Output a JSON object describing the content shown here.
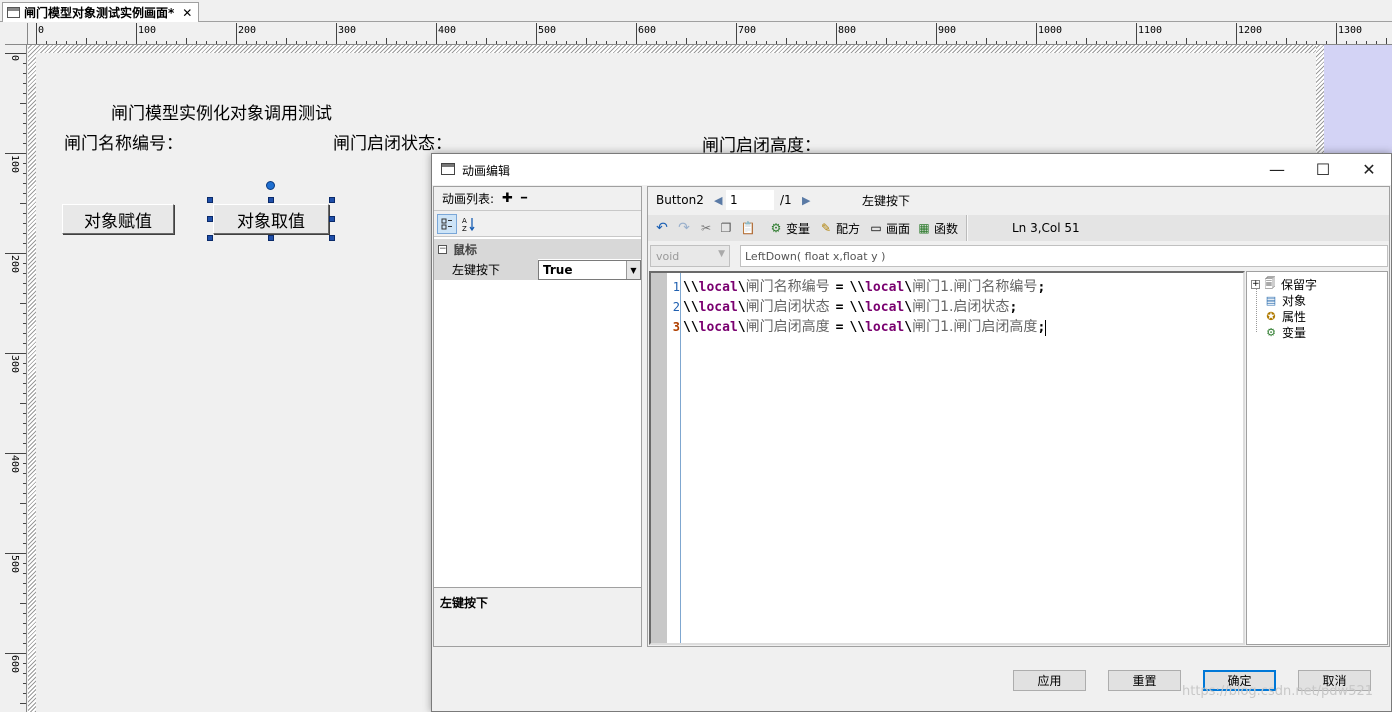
{
  "doc_tab": {
    "title": "闸门模型对象测试实例画面*",
    "close": "✕"
  },
  "ruler_h_labels": [
    "0",
    "100",
    "200",
    "300",
    "400",
    "500",
    "600",
    "700",
    "800",
    "900",
    "1000",
    "1100",
    "1200",
    "1300"
  ],
  "ruler_v_labels": [
    "0",
    "100",
    "200",
    "300",
    "400",
    "500",
    "600"
  ],
  "canvas": {
    "title": "闸门模型实例化对象调用测试",
    "label_name": "闸门名称编号：",
    "label_state": "闸门启闭状态：",
    "label_height": "闸门启闭高度：",
    "btn_assign": "对象赋值",
    "btn_get": "对象取值"
  },
  "dialog": {
    "title": "动画编辑",
    "win_min": "—",
    "win_max": "☐",
    "win_close": "✕",
    "anim_list_label": "动画列表:",
    "add_icon": "✚",
    "remove_icon": "━",
    "category": "鼠标",
    "category_toggle": "−",
    "property_name": "左键按下",
    "property_value": "True",
    "description": "左键按下",
    "object_name": "Button2",
    "page_current": "1",
    "page_total": "/1",
    "event_name": "左键按下",
    "toolbar": {
      "variable": "变量",
      "recipe": "配方",
      "screen": "画面",
      "function": "函数",
      "cursor_pos": "Ln 3,Col 51"
    },
    "return_type": "void",
    "signature": "LeftDown( float x,float y )",
    "code_lines": [
      {
        "num": "1",
        "kw1": "local",
        "lhs": "闸门名称编号",
        "kw2": "local",
        "rhs": "闸门1.闸门名称编号",
        "end": ";"
      },
      {
        "num": "2",
        "kw1": "local",
        "lhs": "闸门启闭状态",
        "kw2": "local",
        "rhs": "闸门1.启闭状态",
        "end": ";"
      },
      {
        "num": "3",
        "kw1": "local",
        "lhs": "闸门启闭高度",
        "kw2": "local",
        "rhs": "闸门1.闸门启闭高度",
        "end": ";"
      }
    ],
    "tree": [
      "保留字",
      "对象",
      "属性",
      "变量"
    ],
    "tree_expander": "+",
    "buttons": {
      "apply": "应用",
      "reset": "重置",
      "ok": "确定",
      "cancel": "取消"
    }
  },
  "watermark": "https://blog.csdn.net/pdw521",
  "colors": {
    "keyword": "#7a0070",
    "offpage": "#d3d3f5",
    "handle": "#1f4faa",
    "linenum": "#2060b0"
  }
}
